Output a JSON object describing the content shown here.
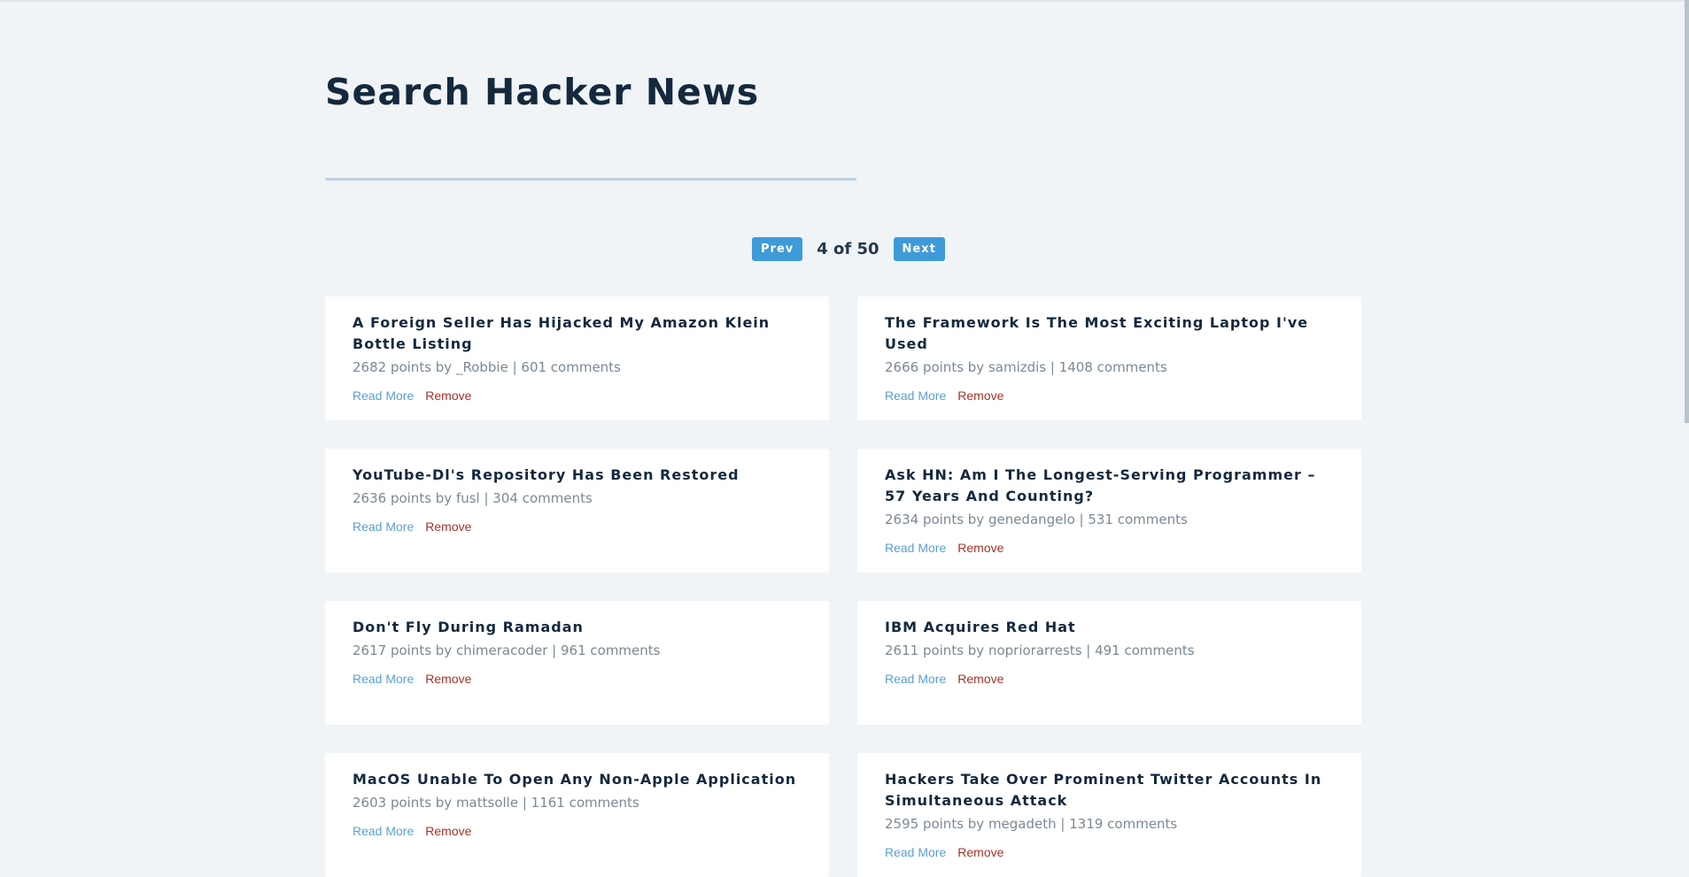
{
  "header": {
    "title": "Search Hacker News"
  },
  "search": {
    "value": "",
    "placeholder": ""
  },
  "pagination": {
    "prev_label": "Prev",
    "next_label": "Next",
    "info": "4 of 50"
  },
  "actions": {
    "read_more": "Read More",
    "remove": "Remove"
  },
  "stories": [
    {
      "title": "A Foreign Seller Has Hijacked My Amazon Klein Bottle Listing",
      "meta": "2682 points by _Robbie | 601 comments"
    },
    {
      "title": "The Framework Is The Most Exciting Laptop I've Used",
      "meta": "2666 points by samizdis | 1408 comments"
    },
    {
      "title": "YouTube-Dl's Repository Has Been Restored",
      "meta": "2636 points by fusl | 304 comments"
    },
    {
      "title": "Ask HN: Am I The Longest-Serving Programmer – 57 Years And Counting?",
      "meta": "2634 points by genedangelo | 531 comments"
    },
    {
      "title": "Don't Fly During Ramadan",
      "meta": "2617 points by chimeracoder | 961 comments"
    },
    {
      "title": "IBM Acquires Red Hat",
      "meta": "2611 points by nopriorarrests | 491 comments"
    },
    {
      "title": "MacOS Unable To Open Any Non-Apple Application",
      "meta": "2603 points by mattsolle | 1161 comments"
    },
    {
      "title": "Hackers Take Over Prominent Twitter Accounts In Simultaneous Attack",
      "meta": "2595 points by megadeth | 1319 comments"
    }
  ],
  "colors": {
    "background": "#f0f4f7",
    "accent": "#3f9ad9",
    "title_text": "#14293d",
    "meta_text": "#7a8996",
    "link": "#5a9fd3",
    "remove": "#a8322a"
  }
}
